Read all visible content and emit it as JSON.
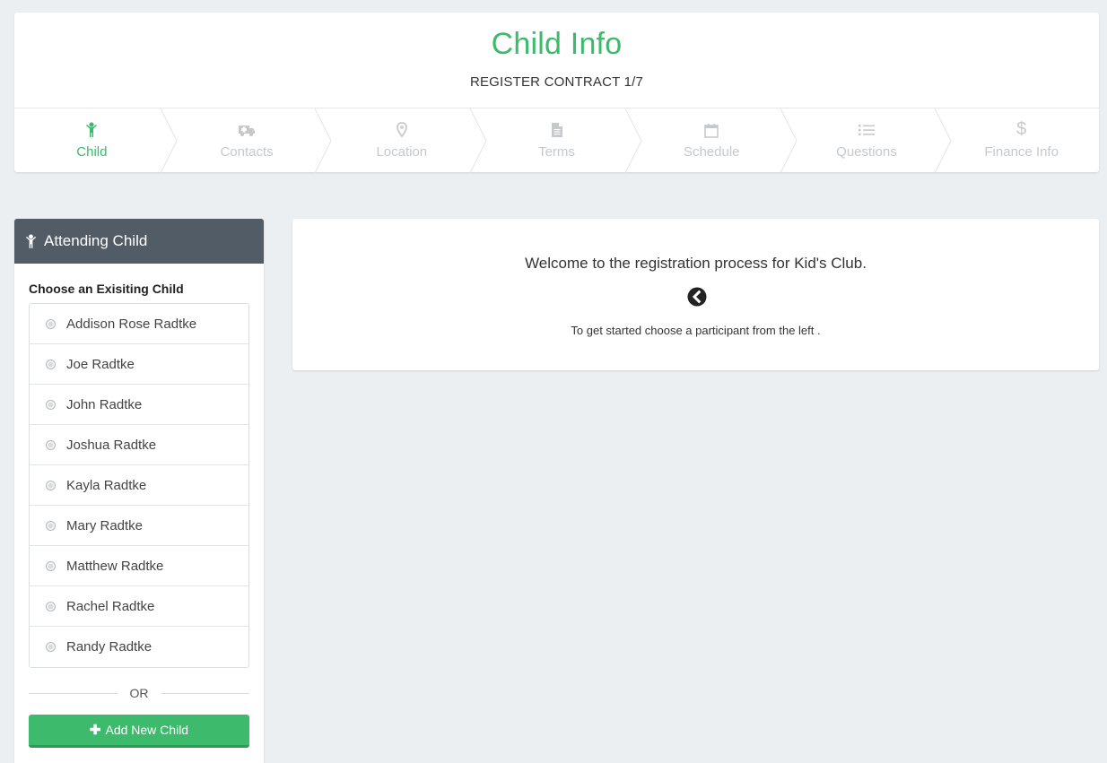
{
  "header": {
    "title": "Child Info",
    "subtitle": "REGISTER CONTRACT 1/7"
  },
  "steps": [
    {
      "label": "Child",
      "icon": "child-icon",
      "active": true
    },
    {
      "label": "Contacts",
      "icon": "ambulance-icon",
      "active": false
    },
    {
      "label": "Location",
      "icon": "map-marker-icon",
      "active": false
    },
    {
      "label": "Terms",
      "icon": "document-icon",
      "active": false
    },
    {
      "label": "Schedule",
      "icon": "calendar-icon",
      "active": false
    },
    {
      "label": "Questions",
      "icon": "list-icon",
      "active": false
    },
    {
      "label": "Finance Info",
      "icon": "dollar-icon",
      "active": false
    }
  ],
  "sidebar": {
    "heading": "Attending Child",
    "choose_label": "Choose an Exisiting Child",
    "children": [
      "Addison Rose Radtke",
      "Joe Radtke",
      "John Radtke",
      "Joshua Radtke",
      "Kayla Radtke",
      "Mary Radtke",
      "Matthew Radtke",
      "Rachel Radtke",
      "Randy Radtke"
    ],
    "or_text": "OR",
    "add_button_label": "Add New Child"
  },
  "welcome": {
    "message": "Welcome to the registration process for Kid's Club.",
    "hint": "To get started choose a participant from the left ."
  },
  "colors": {
    "accent": "#3dba6c",
    "panel_header": "#525c66",
    "background": "#eceff1",
    "inactive_step": "#c6c9cc"
  }
}
